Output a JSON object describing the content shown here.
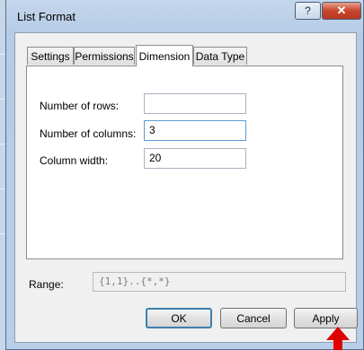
{
  "window": {
    "title": "List Format",
    "help_label": "?",
    "close_label": "✕"
  },
  "tabs": [
    {
      "label": "Settings",
      "active": false
    },
    {
      "label": "Permissions",
      "active": false
    },
    {
      "label": "Dimension",
      "active": true
    },
    {
      "label": "Data Type",
      "active": false
    }
  ],
  "dimension": {
    "rows_label": "Number of rows:",
    "rows_value": "",
    "columns_label": "Number of columns:",
    "columns_value": "3",
    "width_label": "Column width:",
    "width_value": "20"
  },
  "range": {
    "label": "Range:",
    "value": "{1,1}..{*,*}"
  },
  "buttons": {
    "ok": "OK",
    "cancel": "Cancel",
    "apply": "Apply"
  },
  "colors": {
    "accent": "#3c7fb1",
    "close": "#c9452c",
    "cursor_arrow": "#e00000"
  }
}
